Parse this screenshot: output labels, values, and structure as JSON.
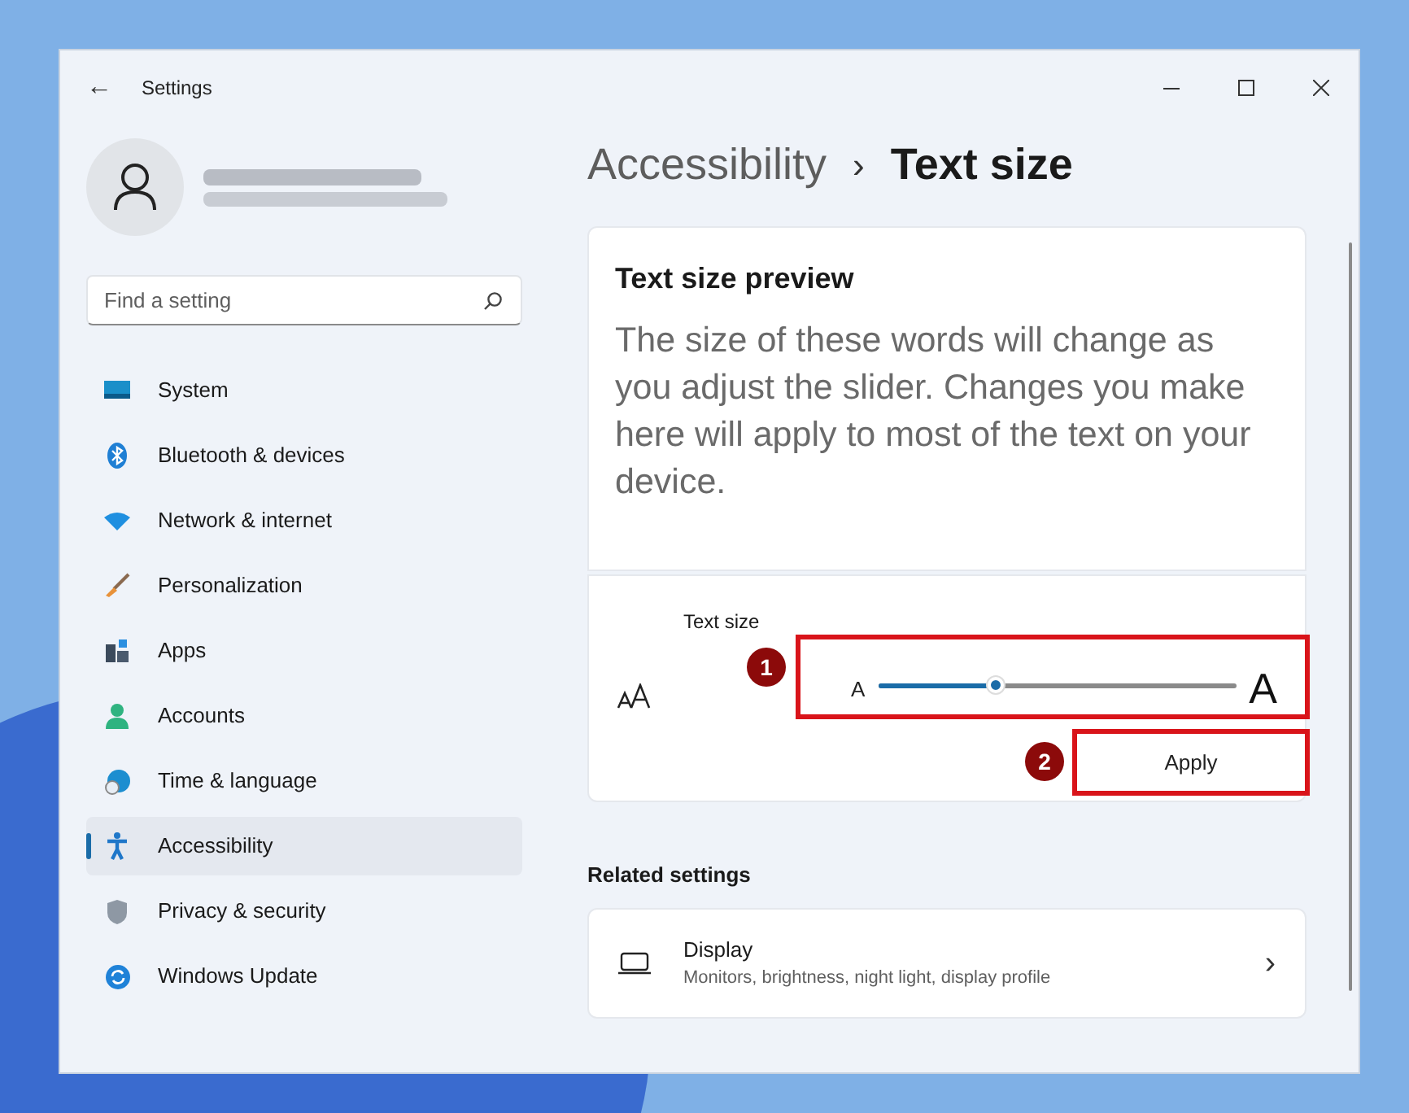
{
  "window": {
    "title": "Settings",
    "back": "←"
  },
  "search": {
    "placeholder": "Find a setting"
  },
  "sidebar": {
    "items": [
      {
        "label": "System",
        "kind": "system",
        "selected": false
      },
      {
        "label": "Bluetooth & devices",
        "kind": "bluetooth",
        "selected": false
      },
      {
        "label": "Network & internet",
        "kind": "wifi",
        "selected": false
      },
      {
        "label": "Personalization",
        "kind": "brush",
        "selected": false
      },
      {
        "label": "Apps",
        "kind": "apps",
        "selected": false
      },
      {
        "label": "Accounts",
        "kind": "person",
        "selected": false
      },
      {
        "label": "Time & language",
        "kind": "globe",
        "selected": false
      },
      {
        "label": "Accessibility",
        "kind": "accessibility",
        "selected": true
      },
      {
        "label": "Privacy & security",
        "kind": "shield",
        "selected": false
      },
      {
        "label": "Windows Update",
        "kind": "update",
        "selected": false
      }
    ]
  },
  "breadcrumb": {
    "parent": "Accessibility",
    "separator": "›",
    "current": "Text size"
  },
  "preview": {
    "title": "Text size preview",
    "text": "The size of these words will change as you adjust the slider. Changes you make here will apply to most of the text on your device."
  },
  "text_size": {
    "label": "Text size",
    "small_a": "A",
    "large_a": "A",
    "level": 0.33,
    "button": "Apply",
    "markers": [
      "1",
      "2"
    ]
  },
  "related": {
    "heading": "Related settings",
    "items": [
      {
        "title": "Display",
        "subtitle": "Monitors, brightness, night light, display profile",
        "chevron": "›"
      }
    ]
  }
}
